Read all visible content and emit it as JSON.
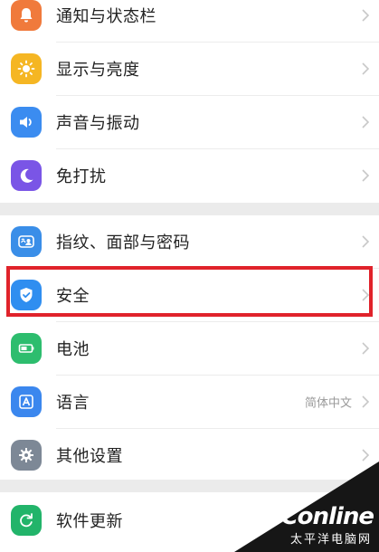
{
  "settings": {
    "items": [
      {
        "label": "通知与状态栏",
        "icon": "notification-icon",
        "color": "#f07a3c"
      },
      {
        "label": "显示与亮度",
        "icon": "brightness-icon",
        "color": "#f5b623"
      },
      {
        "label": "声音与振动",
        "icon": "sound-icon",
        "color": "#3b8cf0"
      },
      {
        "label": "免打扰",
        "icon": "moon-icon",
        "color": "#7a55e6"
      },
      {
        "label": "指纹、面部与密码",
        "icon": "fingerprint-face-icon",
        "color": "#3a8ee8"
      },
      {
        "label": "安全",
        "icon": "shield-icon",
        "color": "#2f8ef0"
      },
      {
        "label": "电池",
        "icon": "battery-icon",
        "color": "#2dbd6e"
      },
      {
        "label": "语言",
        "icon": "language-icon",
        "color": "#3b87ee",
        "value": "简体中文"
      },
      {
        "label": "其他设置",
        "icon": "gear-icon",
        "color": "#7d8896"
      },
      {
        "label": "软件更新",
        "icon": "update-icon",
        "color": "#22b46a"
      }
    ]
  },
  "watermark": {
    "brand": "PConline",
    "subtitle": "太平洋电脑网"
  },
  "colors": {
    "highlight": "#e0232b",
    "background": "#f3f3f3"
  }
}
